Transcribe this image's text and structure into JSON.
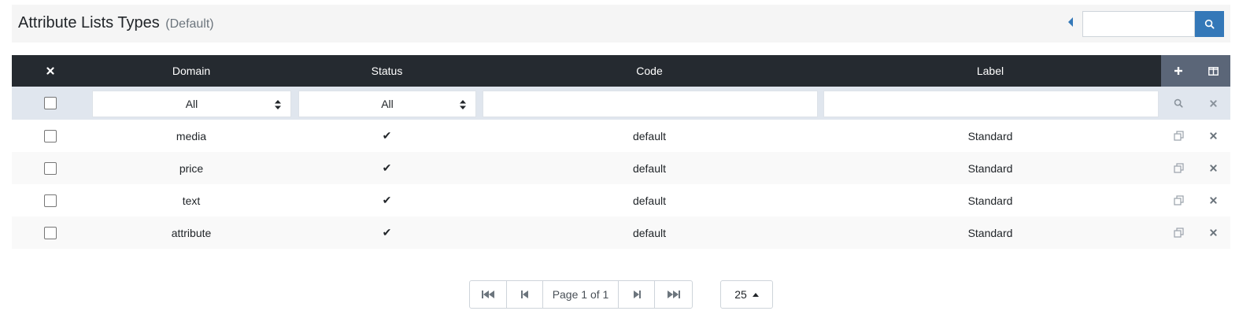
{
  "header": {
    "title": "Attribute Lists Types",
    "subtitle": "(Default)",
    "search_placeholder": ""
  },
  "table": {
    "columns": [
      "Domain",
      "Status",
      "Code",
      "Label"
    ],
    "filters": {
      "domain": "All",
      "status": "All",
      "code": "",
      "label": ""
    },
    "rows": [
      {
        "domain": "media",
        "status": "✔",
        "code": "default",
        "label": "Standard"
      },
      {
        "domain": "price",
        "status": "✔",
        "code": "default",
        "label": "Standard"
      },
      {
        "domain": "text",
        "status": "✔",
        "code": "default",
        "label": "Standard"
      },
      {
        "domain": "attribute",
        "status": "✔",
        "code": "default",
        "label": "Standard"
      }
    ]
  },
  "pagination": {
    "page_label": "Page 1 of 1",
    "page_size": "25"
  },
  "colors": {
    "header_dark": "#252a30",
    "actions_bg": "#5b6678",
    "accent": "#3478b8",
    "filter_bg": "#e0e6ee"
  }
}
